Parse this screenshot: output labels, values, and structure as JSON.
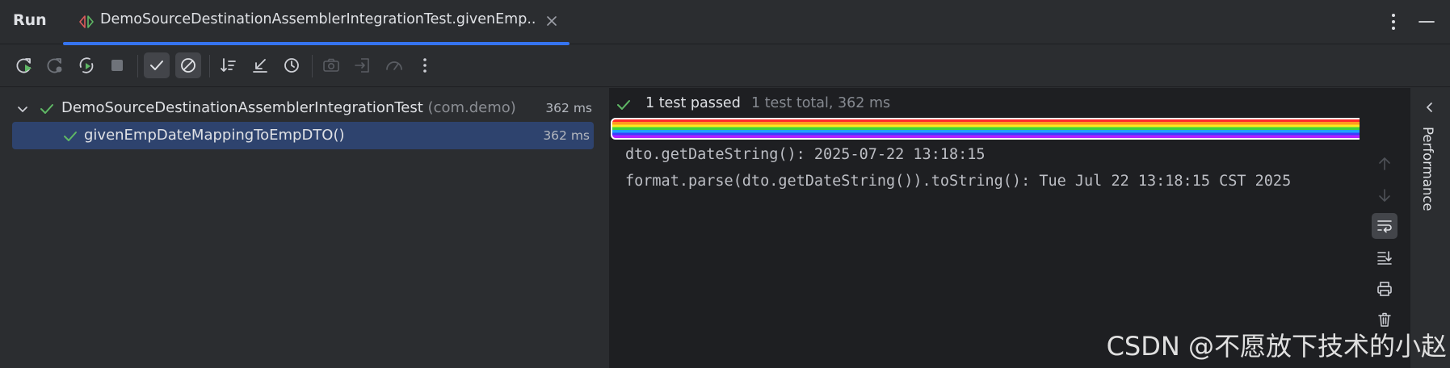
{
  "header": {
    "title": "Run",
    "tab_label": "DemoSourceDestinationAssemblerIntegrationTest.givenEmp..."
  },
  "toolbar": {
    "buttons": [
      {
        "icon": "rerun-icon"
      },
      {
        "icon": "rerun-failed-icon"
      },
      {
        "icon": "toggle-auto-test-icon"
      },
      {
        "icon": "stop-icon"
      },
      {
        "icon": "show-passed-icon"
      },
      {
        "icon": "show-ignored-icon"
      },
      {
        "icon": "sort-alphabetically-icon"
      },
      {
        "icon": "import-tests-icon"
      },
      {
        "icon": "test-history-icon"
      },
      {
        "icon": "screenshot-icon"
      },
      {
        "icon": "export-icon"
      },
      {
        "icon": "coverage-icon"
      },
      {
        "icon": "more-icon"
      }
    ]
  },
  "tree": {
    "items": [
      {
        "name": "DemoSourceDestinationAssemblerIntegrationTest",
        "package": "(com.demo)",
        "duration": "362 ms"
      },
      {
        "name": "givenEmpDateMappingToEmpDTO()",
        "duration": "362 ms"
      }
    ]
  },
  "console": {
    "status_passed": "1 test passed",
    "status_total": "1 test total, 362 ms",
    "progress": 1.0,
    "lines": [
      "dto.getDateString(): 2025-07-22 13:18:15",
      "format.parse(dto.getDateString()).toString(): Tue Jul 22 13:18:15 CST 2025"
    ]
  },
  "right_stripe": {
    "label": "Performance"
  },
  "watermark": "CSDN @不愿放下技术的小赵",
  "colors": {
    "background": "#2b2d30",
    "console_background": "#1e1f22",
    "accent": "#3574f0",
    "success": "#5fb865",
    "selection": "#2e436e"
  }
}
